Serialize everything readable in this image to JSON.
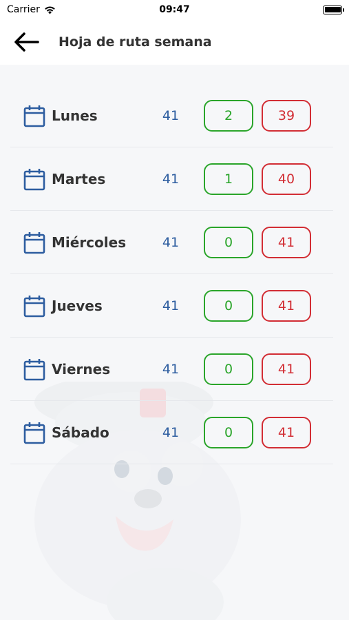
{
  "status_bar": {
    "carrier": "Carrier",
    "time": "09:47"
  },
  "header": {
    "title": "Hoja de ruta semana"
  },
  "days": [
    {
      "label": "Lunes",
      "total": "41",
      "green": "2",
      "red": "39"
    },
    {
      "label": "Martes",
      "total": "41",
      "green": "1",
      "red": "40"
    },
    {
      "label": "Miércoles",
      "total": "41",
      "green": "0",
      "red": "41"
    },
    {
      "label": "Jueves",
      "total": "41",
      "green": "0",
      "red": "41"
    },
    {
      "label": "Viernes",
      "total": "41",
      "green": "0",
      "red": "41"
    },
    {
      "label": "Sábado",
      "total": "41",
      "green": "0",
      "red": "41"
    }
  ],
  "colors": {
    "accent_blue": "#2d5da0",
    "success_green": "#2aa52a",
    "danger_red": "#d22d34"
  }
}
